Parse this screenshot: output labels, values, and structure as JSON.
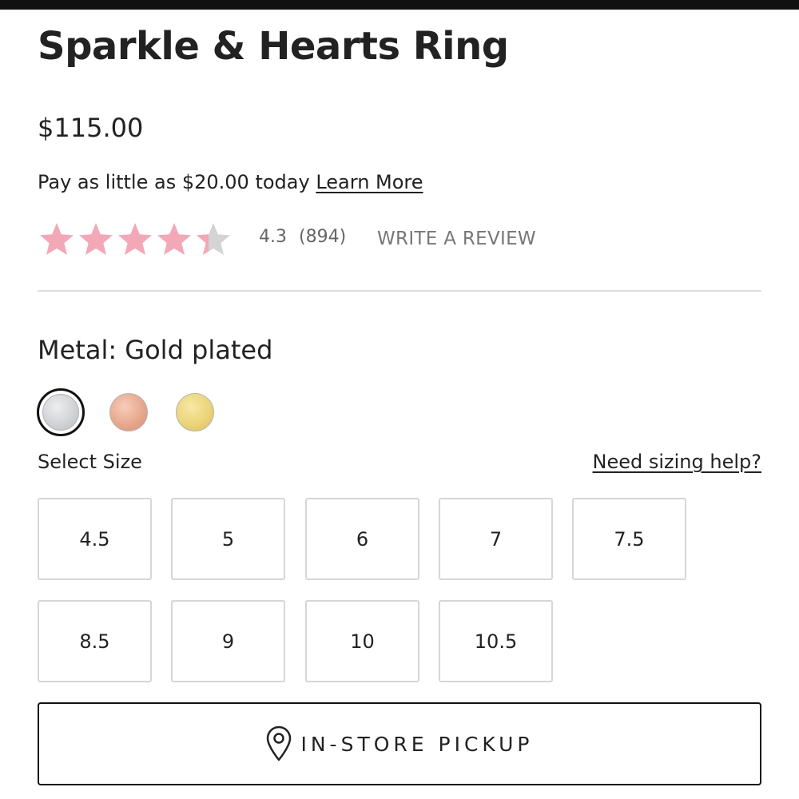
{
  "product": {
    "title": "Sparkle & Hearts Ring",
    "price": "$115.00"
  },
  "payment": {
    "text": "Pay as little as $20.00 today",
    "link_label": "Learn More"
  },
  "rating": {
    "value": "4.3",
    "count": "(894)",
    "stars_filled": 4.3,
    "stars_max": 5,
    "star_color": "#f3a8b8",
    "star_empty_color": "#d4d4d4",
    "write_review_label": "WRITE A REVIEW"
  },
  "metal": {
    "label": "Metal: Gold plated",
    "swatches": [
      {
        "name": "silver",
        "color": "#d2d3d6",
        "selected": true
      },
      {
        "name": "rose-gold",
        "color": "#e8a88e",
        "selected": false
      },
      {
        "name": "gold",
        "color": "#ecd47a",
        "selected": false
      }
    ]
  },
  "size": {
    "label": "Select Size",
    "help_label": "Need sizing help?",
    "options": [
      "4.5",
      "5",
      "6",
      "7",
      "7.5",
      "8.5",
      "9",
      "10",
      "10.5"
    ]
  },
  "pickup": {
    "label": "IN-STORE PICKUP",
    "icon": "location-pin-icon"
  }
}
